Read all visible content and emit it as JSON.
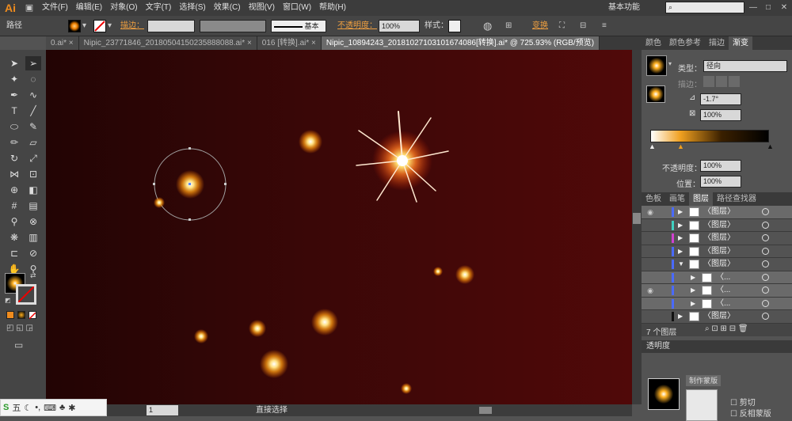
{
  "app": {
    "logo": "Ai",
    "workspace": "基本功能",
    "search_placeholder": ""
  },
  "menu": [
    "文件(F)",
    "编辑(E)",
    "对象(O)",
    "文字(T)",
    "选择(S)",
    "效果(C)",
    "视图(V)",
    "窗口(W)",
    "帮助(H)"
  ],
  "control": {
    "label": "路径",
    "stroke_label": "描边：",
    "brush_label": "基本",
    "opacity_label": "不透明度：",
    "opacity_value": "100%",
    "style_label": "样式：",
    "transform_label": "变换"
  },
  "tabs": [
    {
      "label": "0.ai*  ×",
      "active": false
    },
    {
      "label": "Nipic_23771846_20180504150235888088.ai*  ×",
      "active": false
    },
    {
      "label": "016 [转换].ai*  ×",
      "active": false
    },
    {
      "label": "Nipic_10894243_20181027103101674086[转换].ai* @ 725.93% (RGB/预览)",
      "active": true
    }
  ],
  "gradient_panel": {
    "tabs": [
      "颜色",
      "颜色参考",
      "描边",
      "渐变"
    ],
    "type_label": "类型：",
    "type_value": "径向",
    "stroke_label": "描边：",
    "angle_value": "-1.7°",
    "aspect_value": "100%",
    "opacity_label": "不透明度：",
    "opacity_value": "100%",
    "location_label": "位置：",
    "location_value": "100%"
  },
  "layers_panel": {
    "tabs": [
      "色板",
      "画笔",
      "图层",
      "路径查找器"
    ],
    "rows": [
      {
        "label": "〈图层〉",
        "indent": 0,
        "color": "#4a6aff",
        "visible": true,
        "selected": true
      },
      {
        "label": "〈图层〉",
        "indent": 0,
        "color": "#3fd0c0",
        "visible": false,
        "selected": false
      },
      {
        "label": "〈图层〉",
        "indent": 0,
        "color": "#d040d0",
        "visible": false,
        "selected": false
      },
      {
        "label": "〈图层〉",
        "indent": 0,
        "color": "#4a6aff",
        "visible": false,
        "selected": false
      },
      {
        "label": "〈图层〉",
        "indent": 0,
        "color": "#4a6aff",
        "visible": false,
        "selected": false,
        "expanded": true
      },
      {
        "label": "〈...",
        "indent": 1,
        "color": "#4a6aff",
        "visible": false,
        "selected": true
      },
      {
        "label": "〈...",
        "indent": 1,
        "color": "#4a6aff",
        "visible": true,
        "selected": true
      },
      {
        "label": "〈...",
        "indent": 1,
        "color": "#4a6aff",
        "visible": false,
        "selected": true
      },
      {
        "label": "〈图层〉",
        "indent": 0,
        "color": "#111111",
        "visible": false,
        "selected": false
      }
    ],
    "count_label": "7 个图层"
  },
  "lower_panel": {
    "title": "透明度",
    "btn1": "制作蒙版",
    "opt1": "剪切",
    "opt2": "反相蒙版"
  },
  "status": {
    "zoom": "1",
    "tool": "直接选择"
  },
  "taskbar": {
    "ime": "五"
  },
  "colors": {
    "accent": "#f0a040",
    "canvas_dark": "#220404",
    "canvas_light": "#500909"
  }
}
